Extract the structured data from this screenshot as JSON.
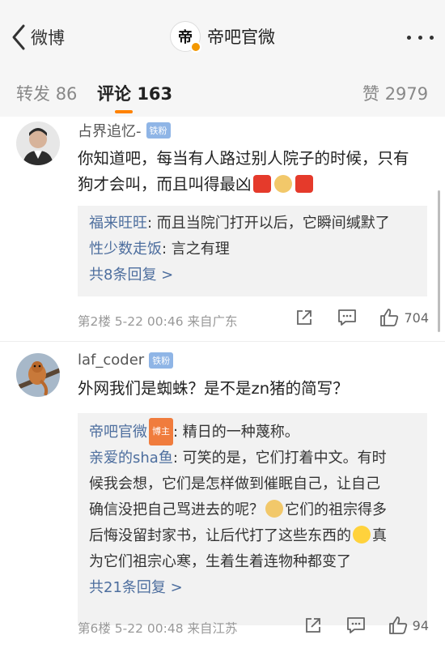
{
  "nav": {
    "back_label": "微博",
    "title": "帝吧官微",
    "logo_char": "帝"
  },
  "tabs": [
    {
      "label": "转发",
      "count": "86"
    },
    {
      "label": "评论",
      "count": "163"
    },
    {
      "label": "赞",
      "count": "2979"
    }
  ],
  "comments": [
    {
      "username": "占界追忆-",
      "fan_badge": "铁粉",
      "text_line1": "你知道吧，每当有人路过别人院子的时候，只有",
      "text_line2": "狗才会叫，而且叫得最凶",
      "replies": [
        {
          "name": "福来旺旺",
          "text": ": 而且当院门打开以后，它瞬间缄默了"
        },
        {
          "name": "性少数走饭",
          "text": ": 言之有理"
        }
      ],
      "more_replies": "共8条回复 >",
      "meta": "第2楼 5-22 00:46 来自广东",
      "likes": "704"
    },
    {
      "username": "laf_coder",
      "fan_badge": "铁粉",
      "text_line1": "外网我们是蜘蛛？是不是zn猪的简写？",
      "replies": [
        {
          "name": "帝吧官微",
          "badge": "博主",
          "text": ": 精日的一种蔑称。"
        },
        {
          "name": "亲爱的sha鱼",
          "text": ": 可笑的是，它们打着中文。有时"
        }
      ],
      "reply_cont": [
        "候我会想，它们是怎样做到催眠自己，让自己",
        "确信没把自己骂进去的呢？",
        "它们的祖宗得多",
        "后悔没留封家书，让后代打了这些东西的",
        "真",
        "为它们祖宗心寒，生着生着连物种都变了"
      ],
      "more_replies": "共21条回复 >",
      "meta": "第6楼 5-22 00:48 来自江苏",
      "likes": "94"
    }
  ],
  "colors": {
    "accent": "#ff8200",
    "link": "#4d6e9e",
    "fan_badge": "#8fb5e6",
    "bozhu_badge": "#f07c3d"
  },
  "icons": [
    "back-chevron-icon",
    "more-dots-icon",
    "share-icon",
    "comment-icon",
    "like-thumb-icon"
  ]
}
